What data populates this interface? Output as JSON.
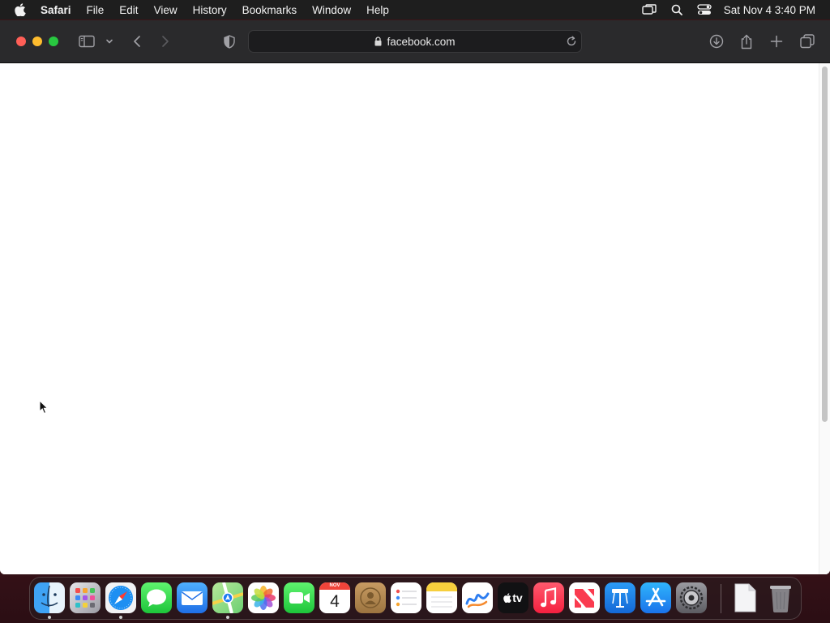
{
  "menubar": {
    "app_name": "Safari",
    "items": [
      "File",
      "Edit",
      "View",
      "History",
      "Bookmarks",
      "Window",
      "Help"
    ],
    "clock": "Sat Nov 4  3:40 PM"
  },
  "toolbar": {
    "url": "facebook.com"
  },
  "dock": {
    "calendar_month": "NOV",
    "calendar_day": "4",
    "tv_label": "tv",
    "apps": [
      "Finder",
      "Launchpad",
      "Safari",
      "Messages",
      "Mail",
      "Maps",
      "Photos",
      "FaceTime",
      "Calendar",
      "Contacts",
      "Reminders",
      "Notes",
      "Freeform",
      "TV",
      "Music",
      "News",
      "Keynote",
      "App Store",
      "System Settings",
      "Document",
      "Trash"
    ]
  },
  "colors": {
    "close": "#ff5f57",
    "minimize": "#febc2e",
    "maximize": "#28c840",
    "menubar": "#1e1e1e",
    "toolbar": "#2a2a2c"
  }
}
